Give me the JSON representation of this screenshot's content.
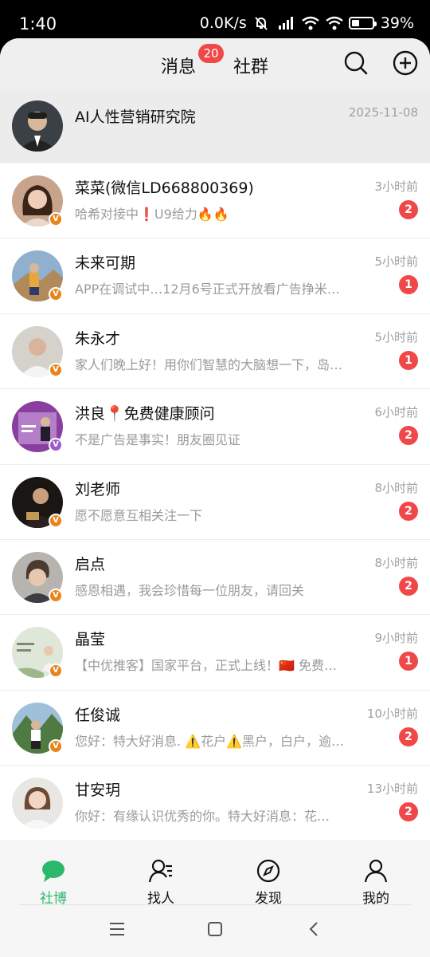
{
  "status_bar": {
    "time": "1:40",
    "speed": "0.0K/s",
    "battery": "39%",
    "battery_level": 0.39
  },
  "header": {
    "tab_messages": "消息",
    "tab_messages_badge": "20",
    "tab_community": "社群"
  },
  "pinned": {
    "name": "AI人性营销研究院",
    "date": "2025-11-08"
  },
  "conversations": [
    {
      "name": "菜菜(微信LD668800369)",
      "preview": "哈希对接中❗U9给力🔥🔥",
      "time": "3小时前",
      "unread": "2",
      "badge": "V",
      "badge_color": "#e8851a"
    },
    {
      "name": "未来可期",
      "preview": "APP在调试中…12月6号正式开放看广告挣米…",
      "time": "5小时前",
      "unread": "1",
      "badge": "V",
      "badge_color": "#e8851a"
    },
    {
      "name": "朱永才",
      "preview": "家人们晚上好！用你们智慧的大脑想一下，岛…",
      "time": "5小时前",
      "unread": "1",
      "badge": "V",
      "badge_color": "#e8851a"
    },
    {
      "name": "洪良📍免费健康顾问",
      "preview": "不是广告是事实！朋友圈见证",
      "time": "6小时前",
      "unread": "2",
      "badge": "V",
      "badge_color": "#9c5cc7"
    },
    {
      "name": "刘老师",
      "preview": "愿不愿意互相关注一下",
      "time": "8小时前",
      "unread": "2",
      "badge": "V",
      "badge_color": "#e8851a"
    },
    {
      "name": "启点",
      "preview": "感恩相遇，我会珍惜每一位朋友，请回关",
      "time": "8小时前",
      "unread": "2",
      "badge": "V",
      "badge_color": "#e8851a"
    },
    {
      "name": "晶莹",
      "preview": "【中优推客】国家平台，正式上线！🇨🇳 免费…",
      "time": "9小时前",
      "unread": "1",
      "badge": "V",
      "badge_color": "#e8851a"
    },
    {
      "name": "任俊诚",
      "preview": "您好：特大好消息. ⚠️花户⚠️黑户，白户，逾…",
      "time": "10小时前",
      "unread": "2",
      "badge": "V",
      "badge_color": "#e8851a"
    },
    {
      "name": "甘安玥",
      "preview": "你好：有缘认识优秀的你。特大好消息：花…",
      "time": "13小时前",
      "unread": "2",
      "badge": "",
      "badge_color": ""
    }
  ],
  "bottom_nav": [
    {
      "label": "社博",
      "icon": "chat-bubble-icon",
      "active": true
    },
    {
      "label": "找人",
      "icon": "find-people-icon",
      "active": false
    },
    {
      "label": "发现",
      "icon": "compass-icon",
      "active": false
    },
    {
      "label": "我的",
      "icon": "profile-icon",
      "active": false
    }
  ],
  "colors": {
    "accent_green": "#2bb86a",
    "badge_red": "#f04848"
  }
}
